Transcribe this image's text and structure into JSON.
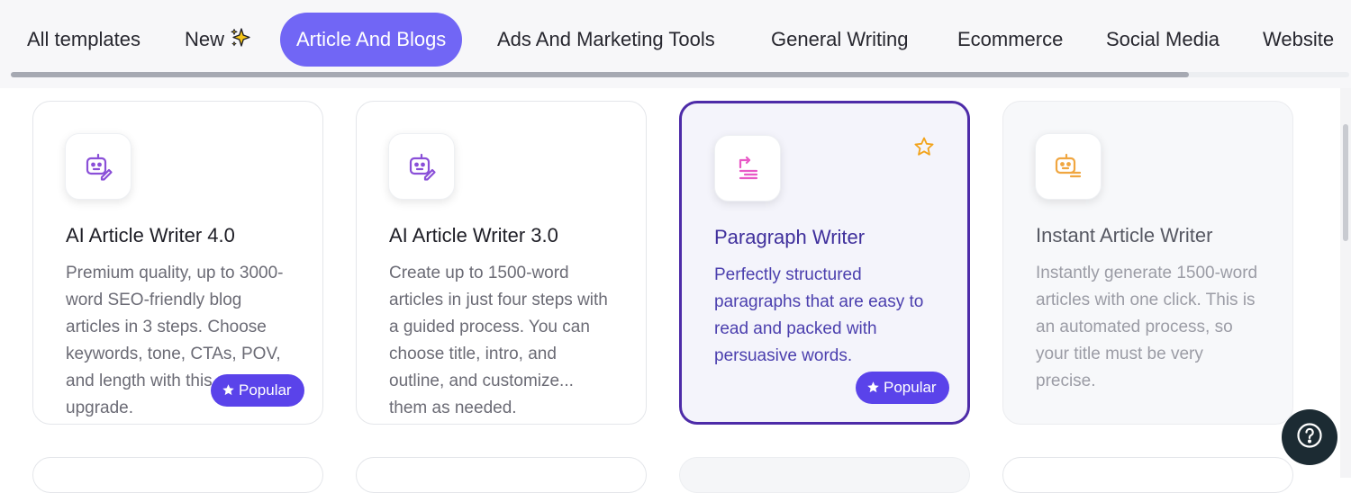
{
  "tabs": [
    {
      "label": "All templates",
      "active": false
    },
    {
      "label": "New",
      "active": false,
      "icon": "sparkle-icon"
    },
    {
      "label": "Article And Blogs",
      "active": true
    },
    {
      "label": "Ads And Marketing Tools",
      "active": false
    },
    {
      "label": "General Writing",
      "active": false
    },
    {
      "label": "Ecommerce",
      "active": false
    },
    {
      "label": "Social Media",
      "active": false
    },
    {
      "label": "Website",
      "active": false
    }
  ],
  "cards": [
    {
      "title": "AI Article Writer 4.0",
      "description": "Premium quality, up to 3000-word SEO-friendly blog articles in 3 steps. Choose keywords, tone, CTAs, POV, and length with this new upgrade.",
      "badge": "Popular",
      "icon": "robot-pen-icon",
      "icon_color": "#8a4fd8"
    },
    {
      "title": "AI Article Writer 3.0",
      "description": "Create up to 1500-word articles in just four steps with a guided process. You can choose title, intro, and outline, and customize... them as needed.",
      "icon": "robot-pen-icon",
      "icon_color": "#8a4fd8"
    },
    {
      "title": "Paragraph Writer",
      "description": "Perfectly structured paragraphs that are easy to read and packed with persuasive words.",
      "badge": "Popular",
      "icon": "paragraph-export-icon",
      "icon_color": "#e859c6",
      "favorite_icon": "star-outline-icon"
    },
    {
      "title": "Instant Article Writer",
      "description": "Instantly generate 1500-word articles with one click. This is an automated process, so your title must be very precise.",
      "icon": "robot-list-icon",
      "icon_color": "#f0a640"
    }
  ],
  "colors": {
    "accent": "#7166f5",
    "badge": "#5a43ea",
    "selected_border": "#4d2ba8",
    "star": "#f2a31b"
  },
  "help": {
    "icon": "question-circle-icon"
  }
}
